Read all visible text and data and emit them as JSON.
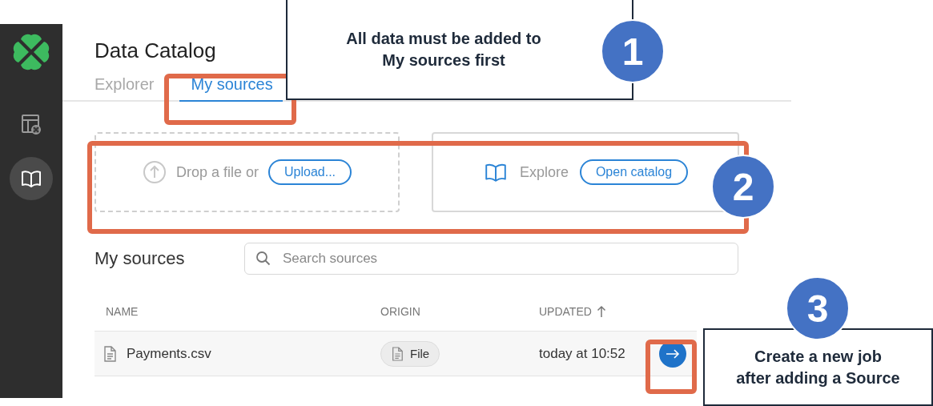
{
  "sidebar": {
    "items": [
      {
        "kind": "table",
        "selected": false
      },
      {
        "kind": "catalog",
        "selected": true
      }
    ]
  },
  "page": {
    "title": "Data Catalog"
  },
  "tabs": [
    {
      "label": "Explorer",
      "selected": false
    },
    {
      "label": "My sources",
      "selected": true
    }
  ],
  "upload": {
    "text": "Drop a file or",
    "button": "Upload..."
  },
  "explore": {
    "text": "Explore",
    "button": "Open catalog"
  },
  "sources": {
    "heading": "My sources",
    "search": {
      "placeholder": "Search sources"
    }
  },
  "table": {
    "columns": [
      {
        "label": "NAME",
        "sorted": false
      },
      {
        "label": "ORIGIN",
        "sorted": false
      },
      {
        "label": "UPDATED",
        "sorted": true
      }
    ],
    "rows": [
      {
        "name": "Payments.csv",
        "origin": "File",
        "updated": "today at 10:52"
      }
    ]
  },
  "annotations": [
    {
      "number": "1",
      "text": "All data must be added to\nMy sources first"
    },
    {
      "number": "2"
    },
    {
      "number": "3",
      "text": "Create a new job\nafter adding a Source"
    }
  ]
}
